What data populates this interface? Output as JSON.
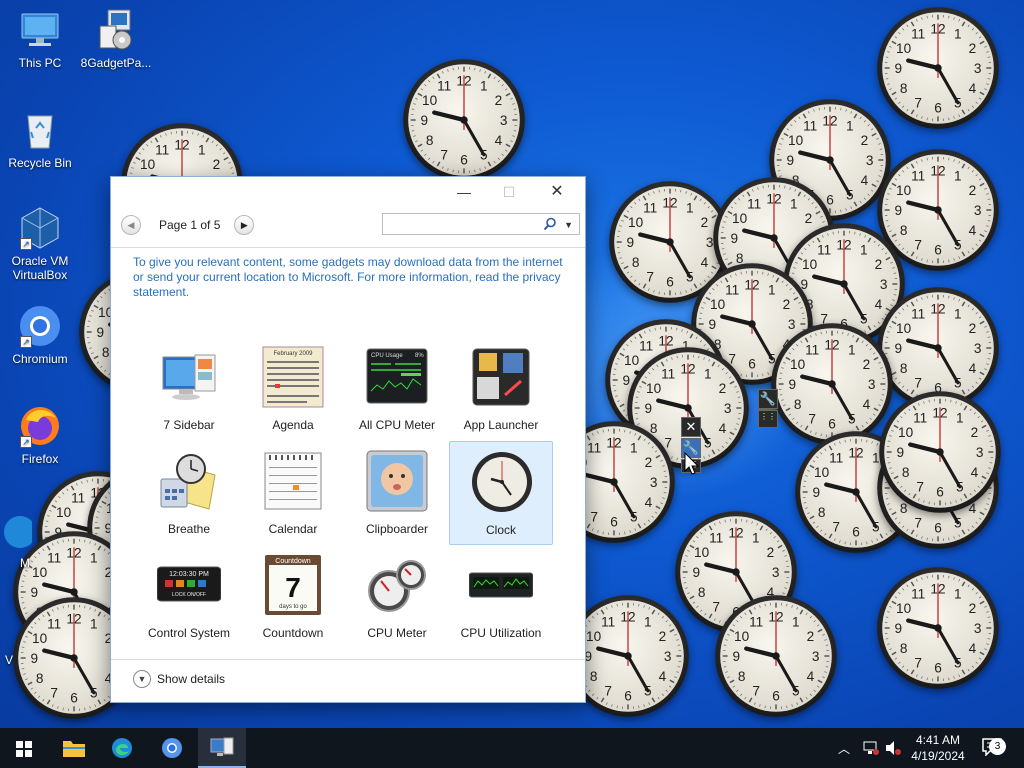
{
  "desktop": {
    "icons": [
      {
        "label": "This PC",
        "icon": "this-pc-icon"
      },
      {
        "label": "8GadgetPa...",
        "icon": "installer-icon"
      },
      {
        "label": "Recycle Bin",
        "icon": "recycle-bin-icon"
      },
      {
        "label": "Oracle VM VirtualBox",
        "icon": "virtualbox-icon"
      },
      {
        "label": "Chromium",
        "icon": "chromium-icon"
      },
      {
        "label": "Firefox",
        "icon": "firefox-icon"
      }
    ],
    "partial_labels": [
      "M",
      "V"
    ]
  },
  "dialog": {
    "pager": {
      "label": "Page 1 of 5"
    },
    "search": {
      "value": "",
      "placeholder": ""
    },
    "notice": "To give you relevant content, some gadgets may download data from the internet or send your current location to Microsoft. For more information, read the privacy statement.",
    "gadgets": [
      {
        "label": "7 Sidebar",
        "icon": "sidebar-gadget-icon"
      },
      {
        "label": "Agenda",
        "icon": "agenda-gadget-icon"
      },
      {
        "label": "All CPU Meter",
        "icon": "all-cpu-meter-gadget-icon"
      },
      {
        "label": "App Launcher",
        "icon": "app-launcher-gadget-icon"
      },
      {
        "label": "Breathe",
        "icon": "breathe-gadget-icon"
      },
      {
        "label": "Calendar",
        "icon": "calendar-gadget-icon"
      },
      {
        "label": "Clipboarder",
        "icon": "clipboarder-gadget-icon"
      },
      {
        "label": "Clock",
        "icon": "clock-gadget-icon",
        "selected": true
      },
      {
        "label": "Control System",
        "icon": "control-system-gadget-icon"
      },
      {
        "label": "Countdown",
        "icon": "countdown-gadget-icon"
      },
      {
        "label": "CPU Meter",
        "icon": "cpu-meter-gadget-icon"
      },
      {
        "label": "CPU Utilization",
        "icon": "cpu-utilization-gadget-icon"
      }
    ],
    "icon_text": {
      "agenda_month": "February 2009",
      "all_cpu_title": "CPU Usage",
      "all_cpu_pct": "8%",
      "control_time": "12:03:30 PM",
      "control_lock": "LOCK ON/OFF",
      "countdown_title": "Countdown",
      "countdown_num": "7",
      "countdown_sub": "days to go"
    },
    "show_details": "Show details"
  },
  "taskbar": {
    "time": "4:41 AM",
    "date": "4/19/2024",
    "notification_count": "3",
    "apps": [
      "start-icon",
      "file-explorer-icon",
      "edge-icon",
      "chromium-icon",
      "gadgets-icon"
    ]
  },
  "colors": {
    "desktop": "#0e5ad2",
    "taskbar": "#10161e",
    "link": "#2a6fbe",
    "selection": "#dfeefd"
  }
}
